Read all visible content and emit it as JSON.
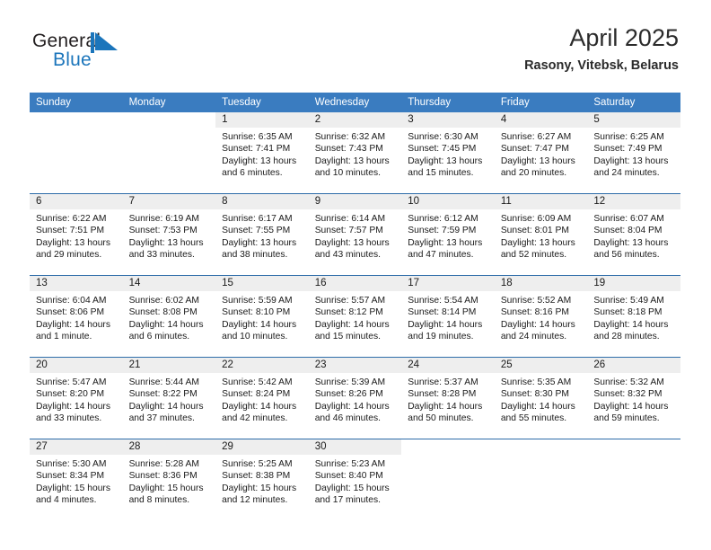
{
  "brand": {
    "word1": "General",
    "word2": "Blue",
    "flag_icon": "blue-triangle-flag-icon",
    "color_dark": "#231f20",
    "color_blue": "#1b75bb"
  },
  "header": {
    "title": "April 2025",
    "subtitle": "Rasony, Vitebsk, Belarus"
  },
  "theme": {
    "header_bg": "#3a7cc0",
    "header_text": "#ffffff",
    "row_divider": "#2e6da9",
    "daynum_bg": "#eeeeee"
  },
  "weekday_headers": [
    "Sunday",
    "Monday",
    "Tuesday",
    "Wednesday",
    "Thursday",
    "Friday",
    "Saturday"
  ],
  "weeks": [
    [
      {
        "day": "",
        "sunrise": "",
        "sunset": "",
        "daylight1": "",
        "daylight2": ""
      },
      {
        "day": "",
        "sunrise": "",
        "sunset": "",
        "daylight1": "",
        "daylight2": ""
      },
      {
        "day": "1",
        "sunrise": "Sunrise: 6:35 AM",
        "sunset": "Sunset: 7:41 PM",
        "daylight1": "Daylight: 13 hours",
        "daylight2": "and 6 minutes."
      },
      {
        "day": "2",
        "sunrise": "Sunrise: 6:32 AM",
        "sunset": "Sunset: 7:43 PM",
        "daylight1": "Daylight: 13 hours",
        "daylight2": "and 10 minutes."
      },
      {
        "day": "3",
        "sunrise": "Sunrise: 6:30 AM",
        "sunset": "Sunset: 7:45 PM",
        "daylight1": "Daylight: 13 hours",
        "daylight2": "and 15 minutes."
      },
      {
        "day": "4",
        "sunrise": "Sunrise: 6:27 AM",
        "sunset": "Sunset: 7:47 PM",
        "daylight1": "Daylight: 13 hours",
        "daylight2": "and 20 minutes."
      },
      {
        "day": "5",
        "sunrise": "Sunrise: 6:25 AM",
        "sunset": "Sunset: 7:49 PM",
        "daylight1": "Daylight: 13 hours",
        "daylight2": "and 24 minutes."
      }
    ],
    [
      {
        "day": "6",
        "sunrise": "Sunrise: 6:22 AM",
        "sunset": "Sunset: 7:51 PM",
        "daylight1": "Daylight: 13 hours",
        "daylight2": "and 29 minutes."
      },
      {
        "day": "7",
        "sunrise": "Sunrise: 6:19 AM",
        "sunset": "Sunset: 7:53 PM",
        "daylight1": "Daylight: 13 hours",
        "daylight2": "and 33 minutes."
      },
      {
        "day": "8",
        "sunrise": "Sunrise: 6:17 AM",
        "sunset": "Sunset: 7:55 PM",
        "daylight1": "Daylight: 13 hours",
        "daylight2": "and 38 minutes."
      },
      {
        "day": "9",
        "sunrise": "Sunrise: 6:14 AM",
        "sunset": "Sunset: 7:57 PM",
        "daylight1": "Daylight: 13 hours",
        "daylight2": "and 43 minutes."
      },
      {
        "day": "10",
        "sunrise": "Sunrise: 6:12 AM",
        "sunset": "Sunset: 7:59 PM",
        "daylight1": "Daylight: 13 hours",
        "daylight2": "and 47 minutes."
      },
      {
        "day": "11",
        "sunrise": "Sunrise: 6:09 AM",
        "sunset": "Sunset: 8:01 PM",
        "daylight1": "Daylight: 13 hours",
        "daylight2": "and 52 minutes."
      },
      {
        "day": "12",
        "sunrise": "Sunrise: 6:07 AM",
        "sunset": "Sunset: 8:04 PM",
        "daylight1": "Daylight: 13 hours",
        "daylight2": "and 56 minutes."
      }
    ],
    [
      {
        "day": "13",
        "sunrise": "Sunrise: 6:04 AM",
        "sunset": "Sunset: 8:06 PM",
        "daylight1": "Daylight: 14 hours",
        "daylight2": "and 1 minute."
      },
      {
        "day": "14",
        "sunrise": "Sunrise: 6:02 AM",
        "sunset": "Sunset: 8:08 PM",
        "daylight1": "Daylight: 14 hours",
        "daylight2": "and 6 minutes."
      },
      {
        "day": "15",
        "sunrise": "Sunrise: 5:59 AM",
        "sunset": "Sunset: 8:10 PM",
        "daylight1": "Daylight: 14 hours",
        "daylight2": "and 10 minutes."
      },
      {
        "day": "16",
        "sunrise": "Sunrise: 5:57 AM",
        "sunset": "Sunset: 8:12 PM",
        "daylight1": "Daylight: 14 hours",
        "daylight2": "and 15 minutes."
      },
      {
        "day": "17",
        "sunrise": "Sunrise: 5:54 AM",
        "sunset": "Sunset: 8:14 PM",
        "daylight1": "Daylight: 14 hours",
        "daylight2": "and 19 minutes."
      },
      {
        "day": "18",
        "sunrise": "Sunrise: 5:52 AM",
        "sunset": "Sunset: 8:16 PM",
        "daylight1": "Daylight: 14 hours",
        "daylight2": "and 24 minutes."
      },
      {
        "day": "19",
        "sunrise": "Sunrise: 5:49 AM",
        "sunset": "Sunset: 8:18 PM",
        "daylight1": "Daylight: 14 hours",
        "daylight2": "and 28 minutes."
      }
    ],
    [
      {
        "day": "20",
        "sunrise": "Sunrise: 5:47 AM",
        "sunset": "Sunset: 8:20 PM",
        "daylight1": "Daylight: 14 hours",
        "daylight2": "and 33 minutes."
      },
      {
        "day": "21",
        "sunrise": "Sunrise: 5:44 AM",
        "sunset": "Sunset: 8:22 PM",
        "daylight1": "Daylight: 14 hours",
        "daylight2": "and 37 minutes."
      },
      {
        "day": "22",
        "sunrise": "Sunrise: 5:42 AM",
        "sunset": "Sunset: 8:24 PM",
        "daylight1": "Daylight: 14 hours",
        "daylight2": "and 42 minutes."
      },
      {
        "day": "23",
        "sunrise": "Sunrise: 5:39 AM",
        "sunset": "Sunset: 8:26 PM",
        "daylight1": "Daylight: 14 hours",
        "daylight2": "and 46 minutes."
      },
      {
        "day": "24",
        "sunrise": "Sunrise: 5:37 AM",
        "sunset": "Sunset: 8:28 PM",
        "daylight1": "Daylight: 14 hours",
        "daylight2": "and 50 minutes."
      },
      {
        "day": "25",
        "sunrise": "Sunrise: 5:35 AM",
        "sunset": "Sunset: 8:30 PM",
        "daylight1": "Daylight: 14 hours",
        "daylight2": "and 55 minutes."
      },
      {
        "day": "26",
        "sunrise": "Sunrise: 5:32 AM",
        "sunset": "Sunset: 8:32 PM",
        "daylight1": "Daylight: 14 hours",
        "daylight2": "and 59 minutes."
      }
    ],
    [
      {
        "day": "27",
        "sunrise": "Sunrise: 5:30 AM",
        "sunset": "Sunset: 8:34 PM",
        "daylight1": "Daylight: 15 hours",
        "daylight2": "and 4 minutes."
      },
      {
        "day": "28",
        "sunrise": "Sunrise: 5:28 AM",
        "sunset": "Sunset: 8:36 PM",
        "daylight1": "Daylight: 15 hours",
        "daylight2": "and 8 minutes."
      },
      {
        "day": "29",
        "sunrise": "Sunrise: 5:25 AM",
        "sunset": "Sunset: 8:38 PM",
        "daylight1": "Daylight: 15 hours",
        "daylight2": "and 12 minutes."
      },
      {
        "day": "30",
        "sunrise": "Sunrise: 5:23 AM",
        "sunset": "Sunset: 8:40 PM",
        "daylight1": "Daylight: 15 hours",
        "daylight2": "and 17 minutes."
      },
      {
        "day": "",
        "sunrise": "",
        "sunset": "",
        "daylight1": "",
        "daylight2": ""
      },
      {
        "day": "",
        "sunrise": "",
        "sunset": "",
        "daylight1": "",
        "daylight2": ""
      },
      {
        "day": "",
        "sunrise": "",
        "sunset": "",
        "daylight1": "",
        "daylight2": ""
      }
    ]
  ]
}
